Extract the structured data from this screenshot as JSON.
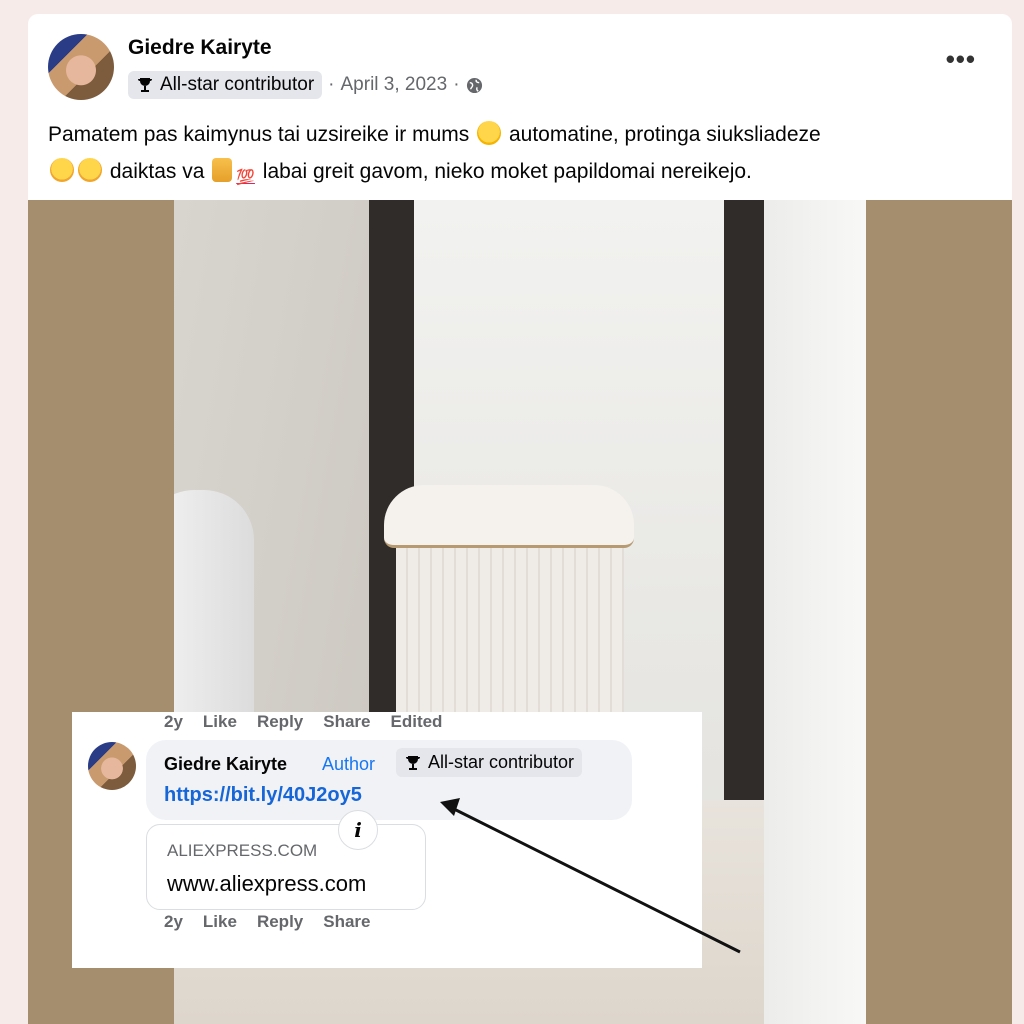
{
  "post": {
    "author": "Giedre Kairyte",
    "badge": "All-star contributor",
    "dot": "·",
    "date": "April 3, 2023",
    "dot2": "·",
    "more": "•••",
    "text_part1": "Pamatem pas kaimynus tai uzsireike ir mums",
    "text_part2": " automatine, protinga siuksliadeze",
    "text_part3": " daiktas va",
    "text_part4": " labai greit gavom, nieko moket papildomai nereikejo.",
    "emoji_hundred": "💯"
  },
  "post_actions": {
    "age": "2y",
    "like": "Like",
    "reply": "Reply",
    "share": "Share",
    "edited": "Edited"
  },
  "comment": {
    "author": "Giedre Kairyte",
    "author_tag": "Author",
    "badge": "All-star contributor",
    "link": "https://bit.ly/40J2oy5",
    "preview_domain": "ALIEXPRESS.COM",
    "preview_title": "www.aliexpress.com",
    "info": "i"
  },
  "comment_actions": {
    "age": "2y",
    "like": "Like",
    "reply": "Reply",
    "share": "Share"
  },
  "colors": {
    "link": "#1666d8",
    "author_tag": "#1877f2",
    "photo_bg": "#a58e6e"
  }
}
